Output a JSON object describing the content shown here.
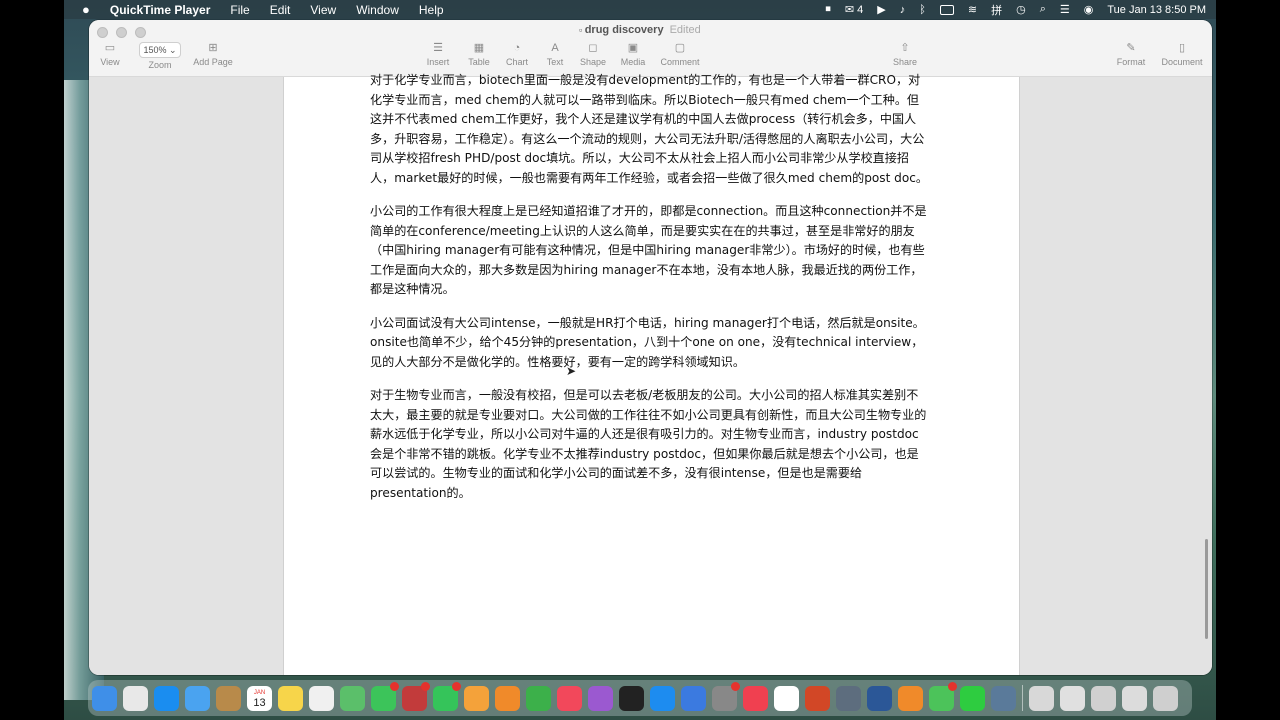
{
  "menubar": {
    "apple": "",
    "app": "QuickTime Player",
    "items": [
      "File",
      "Edit",
      "View",
      "Window",
      "Help"
    ],
    "wechat_count": "4",
    "input_method": "拼",
    "clock": "Tue Jan 13  8:50 PM"
  },
  "window": {
    "title": "drug discovery",
    "status": "Edited"
  },
  "toolbar": {
    "view": "View",
    "zoom_value": "150%",
    "zoom": "Zoom",
    "add_page": "Add Page",
    "insert": "Insert",
    "table": "Table",
    "chart": "Chart",
    "text": "Text",
    "shape": "Shape",
    "media": "Media",
    "comment": "Comment",
    "share": "Share",
    "format": "Format",
    "document": "Document"
  },
  "document": {
    "paragraphs": [
      "对于化学专业而言，biotech里面一般是没有development的工作的，有也是一个人带着一群CRO，对化学专业而言，med chem的人就可以一路带到临床。所以Biotech一般只有med chem一个工种。但这并不代表med chem工作更好，我个人还是建议学有机的中国人去做process（转行机会多，中国人多，升职容易，工作稳定）。有这么一个流动的规则，大公司无法升职/活得憋屈的人离职去小公司，大公司从学校招fresh PHD/post doc填坑。所以，大公司不太从社会上招人而小公司非常少从学校直接招人，market最好的时候，一般也需要有两年工作经验，或者会招一些做了很久med chem的post doc。",
      "小公司的工作有很大程度上是已经知道招谁了才开的，即都是connection。而且这种connection并不是简单的在conference/meeting上认识的人这么简单，而是要实实在在的共事过，甚至是非常好的朋友（中国hiring manager有可能有这种情况，但是中国hiring manager非常少）。市场好的时候，也有些工作是面向大众的，那大多数是因为hiring manager不在本地，没有本地人脉，我最近找的两份工作，都是这种情况。",
      "小公司面试没有大公司intense，一般就是HR打个电话，hiring manager打个电话，然后就是onsite。onsite也简单不少，给个45分钟的presentation，八到十个one on one，没有technical interview，见的人大部分不是做化学的。性格要好，要有一定的跨学科领域知识。",
      "对于生物专业而言，一般没有校招，但是可以去老板/老板朋友的公司。大小公司的招人标准其实差别不太大，最主要的就是专业要对口。大公司做的工作往往不如小公司更具有创新性，而且大公司生物专业的薪水远低于化学专业，所以小公司对牛逼的人还是很有吸引力的。对生物专业而言，industry postdoc会是个非常不错的跳板。化学专业不太推荐industry postdoc，但如果你最后就是想去个小公司，也是可以尝试的。生物专业的面试和化学小公司的面试差不多，没有很intense，但是也是需要给presentation的。"
    ]
  },
  "dock": {
    "apps": [
      "finder-icon",
      "launchpad-icon",
      "safari-icon",
      "mail-icon",
      "contacts-icon",
      "calendar-icon",
      "notes-icon",
      "freeform-icon",
      "maps-icon",
      "messages-icon",
      "photo-booth-icon",
      "facetime-icon",
      "photos-icon",
      "pages-icon",
      "numbers-icon",
      "music-icon",
      "podcasts-icon",
      "tv-icon",
      "app-store-icon",
      "keynote-icon",
      "system-settings-icon",
      "news-icon",
      "chrome-icon",
      "powerpoint-icon",
      "preview-icon",
      "word-icon",
      "books-icon",
      "wechat-mini-icon",
      "wechat-icon",
      "quicktime-icon",
      "folder-icon",
      "screenshot-icon",
      "window-icon",
      "image-icon",
      "trash-icon"
    ],
    "calendar_month": "JAN",
    "calendar_day": "13"
  },
  "colors": {
    "accent": "#e5322d",
    "page_bg": "#ffffff",
    "canvas_bg": "#e3e3e3"
  }
}
